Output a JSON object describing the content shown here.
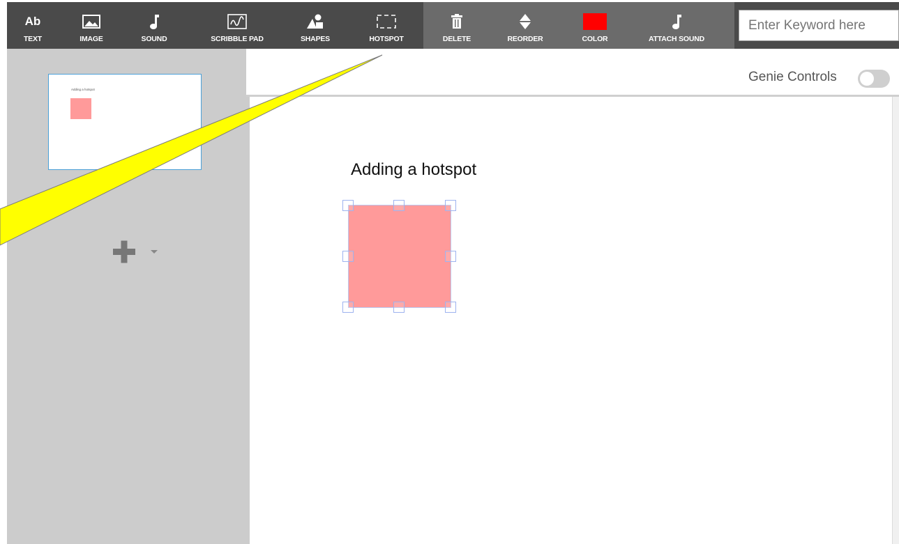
{
  "toolbar": {
    "text_glyph": "Ab",
    "text_label": "TEXT",
    "image_label": "IMAGE",
    "sound_label": "SOUND",
    "scribble_label": "SCRIBBLE PAD",
    "shapes_label": "SHAPES",
    "hotspot_label": "HOTSPOT",
    "delete_label": "DELETE",
    "reorder_label": "REORDER",
    "color_label": "COLOR",
    "attach_sound_label": "ATTACH SOUND",
    "selected_color": "#ff0000"
  },
  "search": {
    "placeholder": "Enter Keyword here"
  },
  "sidebar": {
    "thumbnail_text": "Adding a hotspot",
    "add_slide_icon": "plus-icon",
    "add_slide_menu_icon": "caret-down-icon"
  },
  "header": {
    "genie_label": "Genie Controls",
    "genie_enabled": false
  },
  "canvas": {
    "title": "Adding a hotspot",
    "shape_color": "#ff9a9a"
  },
  "colors": {
    "toolbar_bg": "#4a4a4a",
    "toolbar_group_bg": "#6b6b6b",
    "sidebar_bg": "#cccccc",
    "thumb_border": "#4aa0d8",
    "callout": "#ffff00"
  }
}
